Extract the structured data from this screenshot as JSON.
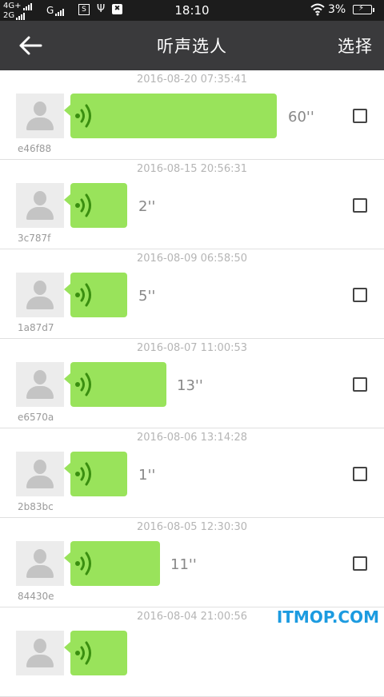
{
  "status_bar": {
    "network_1": "4G+",
    "network_2": "2G",
    "carrier_g": "G",
    "sim_icon": "S",
    "time": "18:10",
    "battery_pct": "3%"
  },
  "header": {
    "title": "听声选人",
    "action": "选择"
  },
  "items": [
    {
      "timestamp": "2016-08-20 07:35:41",
      "duration": "60''",
      "user": "e46f88",
      "checked": false
    },
    {
      "timestamp": "2016-08-15 20:56:31",
      "duration": "2''",
      "user": "3c787f",
      "checked": false
    },
    {
      "timestamp": "2016-08-09 06:58:50",
      "duration": "5''",
      "user": "1a87d7",
      "checked": false
    },
    {
      "timestamp": "2016-08-07 11:00:53",
      "duration": "13''",
      "user": "e6570a",
      "checked": false
    },
    {
      "timestamp": "2016-08-06 13:14:28",
      "duration": "1''",
      "user": "2b83bc",
      "checked": false
    },
    {
      "timestamp": "2016-08-05 12:30:30",
      "duration": "11''",
      "user": "84430e",
      "checked": false
    },
    {
      "timestamp": "2016-08-04 21:00:56",
      "duration": "",
      "user": "",
      "checked": false
    }
  ],
  "watermark": "ITMOP.COM",
  "colors": {
    "status_bar": "#1c1c1c",
    "title_bar": "#3a3a3c",
    "bubble": "#99e35b",
    "wave": "#3a8f10",
    "watermark": "#1c9be0"
  }
}
